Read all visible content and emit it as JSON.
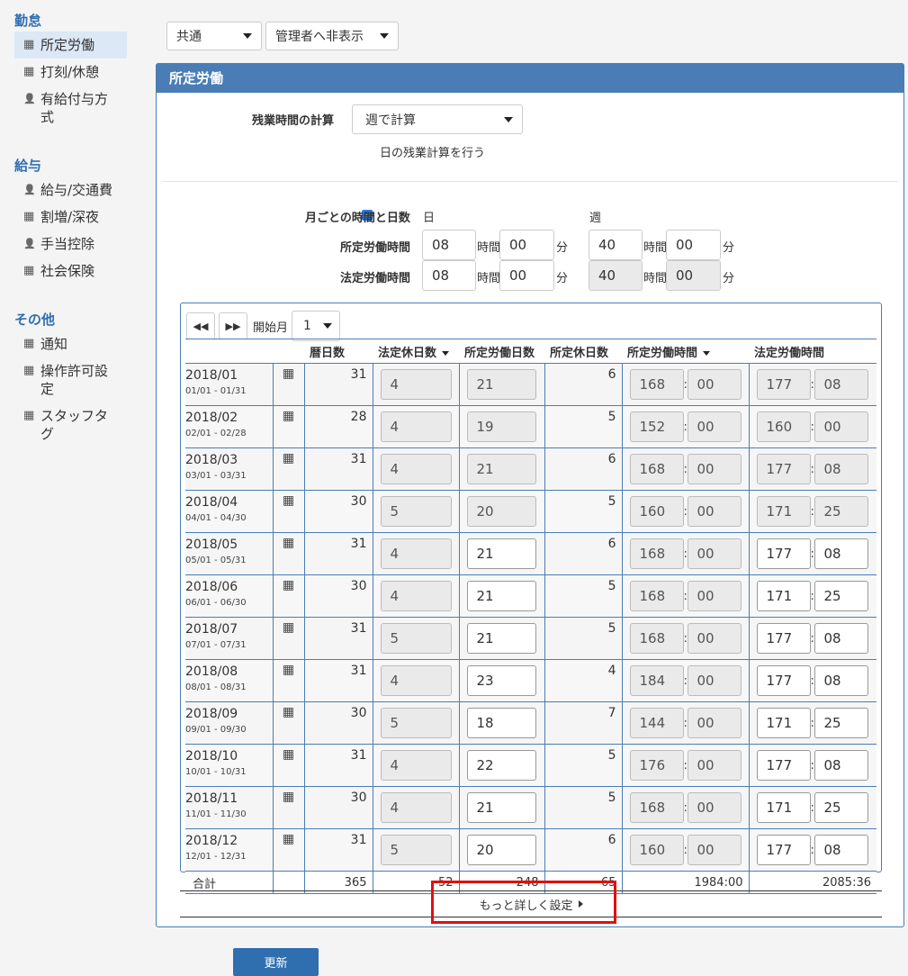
{
  "sidebar": {
    "sections": [
      {
        "title": "勤怠",
        "items": [
          {
            "label": "所定労働",
            "icon": "building-icon",
            "active": true
          },
          {
            "label": "打刻/休憩",
            "icon": "building-icon"
          },
          {
            "label": "有給付与方式",
            "icon": "person-icon"
          }
        ]
      },
      {
        "title": "給与",
        "items": [
          {
            "label": "給与/交通費",
            "icon": "person-icon"
          },
          {
            "label": "割増/深夜",
            "icon": "building-icon"
          },
          {
            "label": "手当控除",
            "icon": "person-icon"
          },
          {
            "label": "社会保険",
            "icon": "building-icon"
          }
        ]
      },
      {
        "title": "その他",
        "items": [
          {
            "label": "通知",
            "icon": "building-icon"
          },
          {
            "label": "操作許可設定",
            "icon": "building-icon"
          },
          {
            "label": "スタッフタグ",
            "icon": "building-icon"
          }
        ]
      }
    ]
  },
  "top": {
    "scope_select": "共通",
    "visibility_select": "管理者へ非表示"
  },
  "panel": {
    "title": "所定労働",
    "overtime_label": "残業時間の計算",
    "overtime_select": "週で計算",
    "daily_check_label": "日の残業計算を行う",
    "monthly_label": "月ごとの時間と日数",
    "day_header": "日",
    "week_header": "週",
    "scheduled_label": "所定労働時間",
    "legal_label": "法定労働時間",
    "unit_hour": "時間",
    "unit_min": "分",
    "scheduled_day_h": "08",
    "scheduled_day_m": "00",
    "scheduled_week_h": "40",
    "scheduled_week_m": "00",
    "legal_day_h": "08",
    "legal_day_m": "00",
    "legal_week_h": "40",
    "legal_week_m": "00"
  },
  "table": {
    "start_month_label": "開始月",
    "start_month_value": "1",
    "headers": [
      "",
      "",
      "暦日数",
      "法定休日数",
      "所定労働日数",
      "所定休日数",
      "所定労働時間",
      "法定労働時間"
    ],
    "rows": [
      {
        "month": "2018/01",
        "range": "01/01 - 01/31",
        "days": "31",
        "legal_off": "4",
        "work_days": "21",
        "work_days_edit": false,
        "sched_off": "6",
        "sched_h": "168",
        "sched_m": "00",
        "legal_h": "177",
        "legal_m": "08",
        "legal_edit": false
      },
      {
        "month": "2018/02",
        "range": "02/01 - 02/28",
        "days": "28",
        "legal_off": "4",
        "work_days": "19",
        "work_days_edit": false,
        "sched_off": "5",
        "sched_h": "152",
        "sched_m": "00",
        "legal_h": "160",
        "legal_m": "00",
        "legal_edit": false
      },
      {
        "month": "2018/03",
        "range": "03/01 - 03/31",
        "days": "31",
        "legal_off": "4",
        "work_days": "21",
        "work_days_edit": false,
        "sched_off": "6",
        "sched_h": "168",
        "sched_m": "00",
        "legal_h": "177",
        "legal_m": "08",
        "legal_edit": false
      },
      {
        "month": "2018/04",
        "range": "04/01 - 04/30",
        "days": "30",
        "legal_off": "5",
        "work_days": "20",
        "work_days_edit": false,
        "sched_off": "5",
        "sched_h": "160",
        "sched_m": "00",
        "legal_h": "171",
        "legal_m": "25",
        "legal_edit": false
      },
      {
        "month": "2018/05",
        "range": "05/01 - 05/31",
        "days": "31",
        "legal_off": "4",
        "work_days": "21",
        "work_days_edit": true,
        "sched_off": "6",
        "sched_h": "168",
        "sched_m": "00",
        "legal_h": "177",
        "legal_m": "08",
        "legal_edit": true
      },
      {
        "month": "2018/06",
        "range": "06/01 - 06/30",
        "days": "30",
        "legal_off": "4",
        "work_days": "21",
        "work_days_edit": true,
        "sched_off": "5",
        "sched_h": "168",
        "sched_m": "00",
        "legal_h": "171",
        "legal_m": "25",
        "legal_edit": true
      },
      {
        "month": "2018/07",
        "range": "07/01 - 07/31",
        "days": "31",
        "legal_off": "5",
        "work_days": "21",
        "work_days_edit": true,
        "sched_off": "5",
        "sched_h": "168",
        "sched_m": "00",
        "legal_h": "177",
        "legal_m": "08",
        "legal_edit": true
      },
      {
        "month": "2018/08",
        "range": "08/01 - 08/31",
        "days": "31",
        "legal_off": "4",
        "work_days": "23",
        "work_days_edit": true,
        "sched_off": "4",
        "sched_h": "184",
        "sched_m": "00",
        "legal_h": "177",
        "legal_m": "08",
        "legal_edit": true
      },
      {
        "month": "2018/09",
        "range": "09/01 - 09/30",
        "days": "30",
        "legal_off": "5",
        "work_days": "18",
        "work_days_edit": true,
        "sched_off": "7",
        "sched_h": "144",
        "sched_m": "00",
        "legal_h": "171",
        "legal_m": "25",
        "legal_edit": true
      },
      {
        "month": "2018/10",
        "range": "10/01 - 10/31",
        "days": "31",
        "legal_off": "4",
        "work_days": "22",
        "work_days_edit": true,
        "sched_off": "5",
        "sched_h": "176",
        "sched_m": "00",
        "legal_h": "177",
        "legal_m": "08",
        "legal_edit": true
      },
      {
        "month": "2018/11",
        "range": "11/01 - 11/30",
        "days": "30",
        "legal_off": "4",
        "work_days": "21",
        "work_days_edit": true,
        "sched_off": "5",
        "sched_h": "168",
        "sched_m": "00",
        "legal_h": "171",
        "legal_m": "25",
        "legal_edit": true
      },
      {
        "month": "2018/12",
        "range": "12/01 - 12/31",
        "days": "31",
        "legal_off": "5",
        "work_days": "20",
        "work_days_edit": true,
        "sched_off": "6",
        "sched_h": "160",
        "sched_m": "00",
        "legal_h": "177",
        "legal_m": "08",
        "legal_edit": true
      }
    ],
    "total": {
      "label": "合計",
      "days": "365",
      "legal_off": "52",
      "work_days": "248",
      "sched_off": "65",
      "sched_time": "1984:00",
      "legal_time": "2085:36"
    }
  },
  "more_settings": "もっと詳しく設定",
  "update_button": "更新",
  "colors": {
    "accent": "#4a7db5",
    "button": "#2f6fb0",
    "highlight": "#e01010"
  }
}
